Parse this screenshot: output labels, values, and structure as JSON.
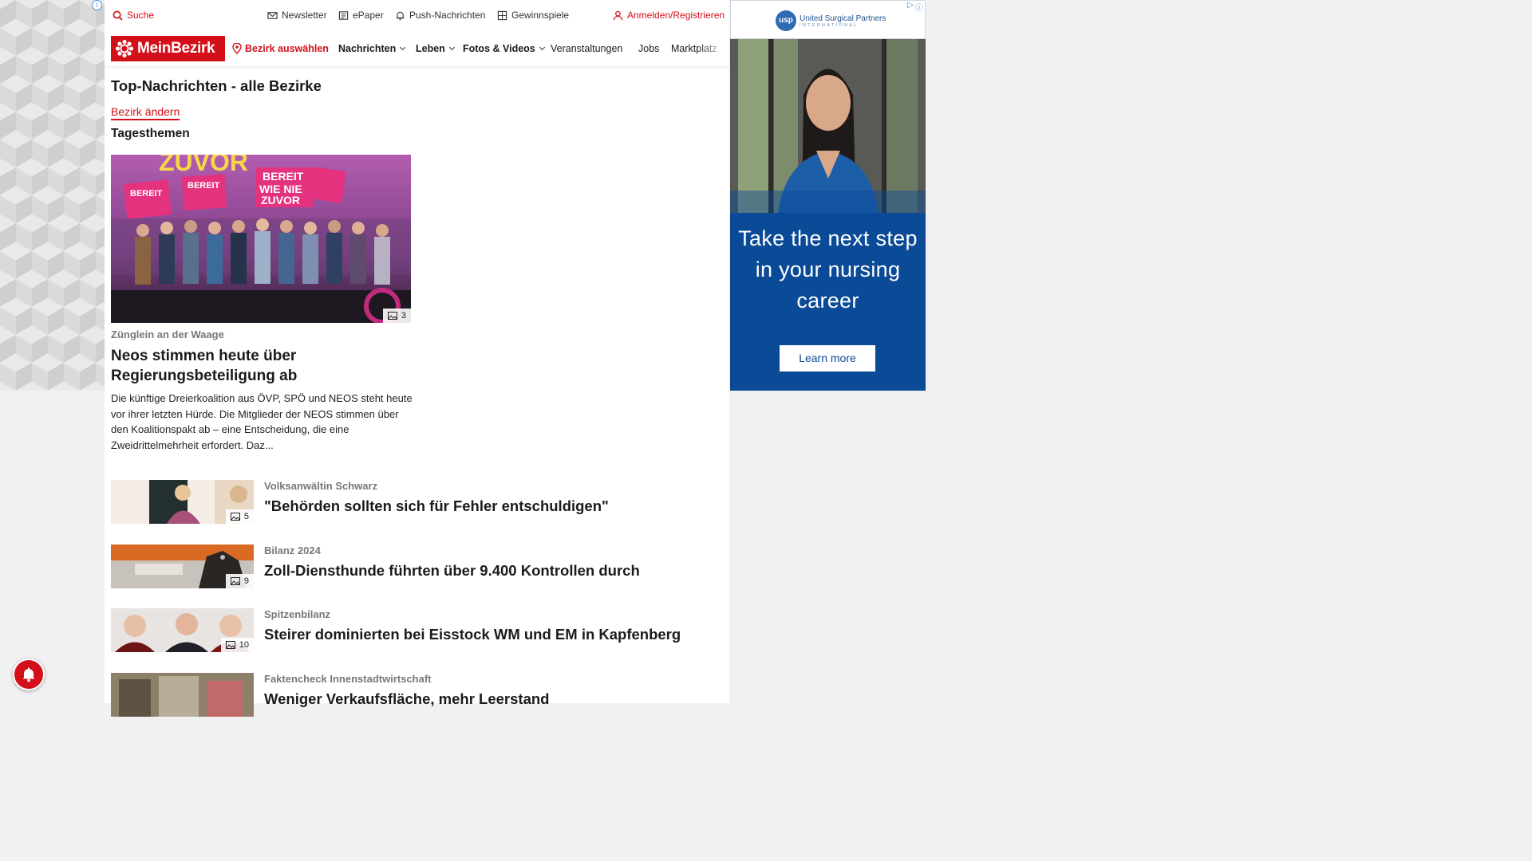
{
  "util": {
    "search": "Suche",
    "newsletter": "Newsletter",
    "epaper": "ePaper",
    "push": "Push-Nachrichten",
    "contests": "Gewinnspiele",
    "login": "Anmelden/Registrieren"
  },
  "nav": {
    "logo": "MeinBezirk",
    "district": "Bezirk auswählen",
    "items": [
      "Nachrichten",
      "Leben",
      "Fotos & Videos",
      "Veranstaltungen",
      "Jobs",
      "Marktplatz"
    ]
  },
  "page": {
    "title": "Top-Nachrichten - alle Bezirke",
    "change_district": "Bezirk ändern",
    "section": "Tagesthemen"
  },
  "hero": {
    "kicker": "Zünglein an der Waage",
    "title": "Neos stimmen heute über Regierungsbeteiligung ab",
    "text": "Die künftige Dreierkoalition aus ÖVP, SPÖ und NEOS steht heute vor ihrer letzten Hürde. Die Mitglieder der NEOS stimmen über den Koalitionspakt ab – eine Entscheidung, die eine Zweidrittelmehrheit erfordert. Daz...",
    "photo_count": "3",
    "sign_text_1": "ZUVOR",
    "sign_text_2": "BEREIT WIE NIE ZUVOR"
  },
  "articles": [
    {
      "kicker": "Volksanwältin Schwarz",
      "title": "\"Behörden sollten sich für Fehler entschuldigen\"",
      "photo_count": "5"
    },
    {
      "kicker": "Bilanz 2024",
      "title": "Zoll-Diensthunde führten über 9.400 Kontrollen durch",
      "photo_count": "9"
    },
    {
      "kicker": "Spitzenbilanz",
      "title": "Steirer dominierten bei Eisstock WM und EM in Kapfenberg",
      "photo_count": "10"
    },
    {
      "kicker": "Faktencheck Innenstadtwirtschaft",
      "title": "Weniger Verkaufsfläche, mehr Leerstand",
      "photo_count": ""
    }
  ],
  "ad": {
    "brand": "United Surgical Partners",
    "brand_sub": "INTERNATIONAL",
    "brand_mark": "usp",
    "headline": "Take the next step in your nursing career",
    "cta": "Learn more"
  },
  "colors": {
    "brand_red": "#d3101a",
    "ad_blue": "#0b4a96"
  }
}
